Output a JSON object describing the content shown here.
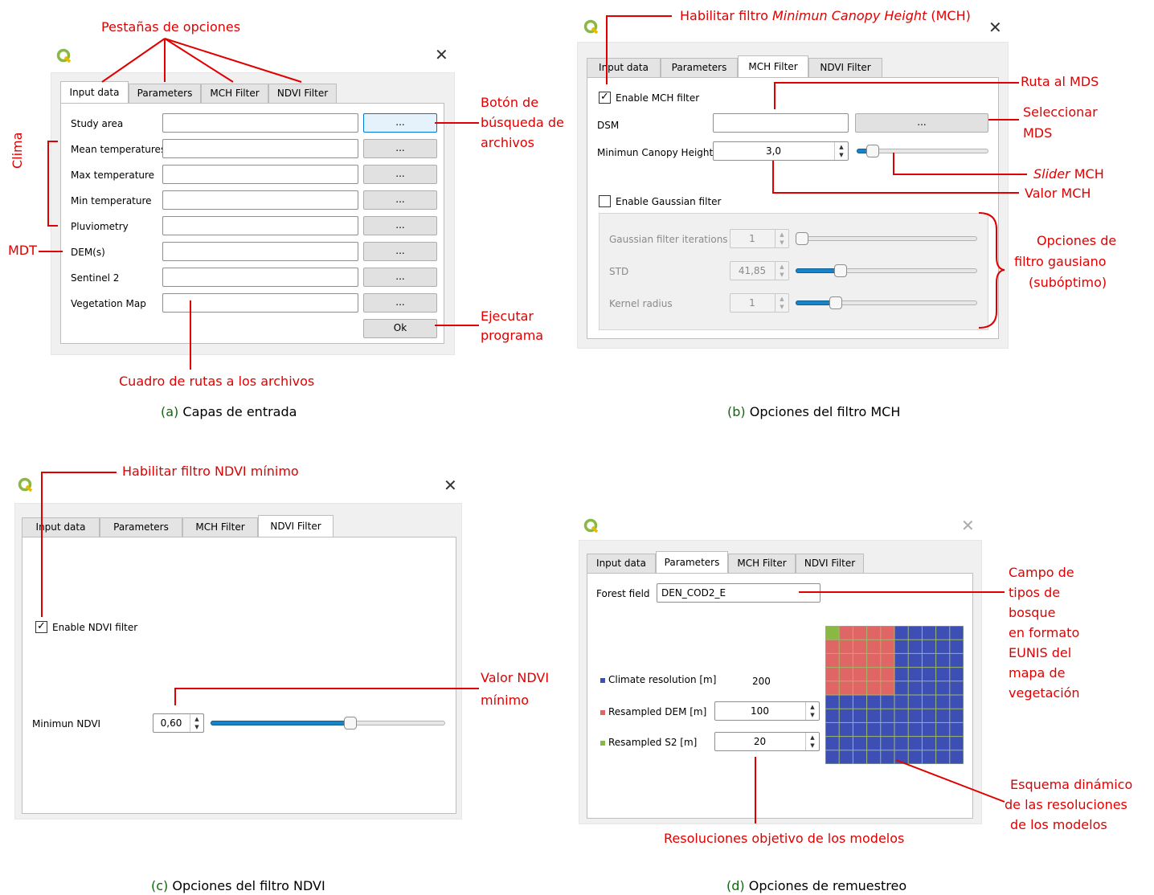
{
  "colors": {
    "annotation": "#e00000",
    "caption_label": "#116611",
    "slider_fill": "#1a82c6",
    "grid_red": "#e06666",
    "grid_blue": "#3d4fb5",
    "grid_green": "#8ab845"
  },
  "icons": {
    "logo": "qgis-logo-icon",
    "close": "close-icon",
    "combo": "spin-arrows-icon"
  },
  "panel_a": {
    "tabs": [
      "Input data",
      "Parameters",
      "MCH Filter",
      "NDVI Filter"
    ],
    "rows": [
      {
        "label": "Study area",
        "browse": "..."
      },
      {
        "label": "Mean temperatures",
        "browse": "..."
      },
      {
        "label": "Max temperature",
        "browse": "..."
      },
      {
        "label": "Min temperature",
        "browse": "..."
      },
      {
        "label": "Pluviometry",
        "browse": "..."
      },
      {
        "label": "DEM(s)",
        "browse": "..."
      },
      {
        "label": "Sentinel 2",
        "browse": "..."
      },
      {
        "label": "Vegetation Map",
        "browse": "..."
      }
    ],
    "ok": "Ok",
    "caption_letter": "(a)",
    "caption": "Capas de entrada",
    "ann_tabs": "Pestañas de opciones",
    "ann_browse": [
      "Botón de",
      "búsqueda de",
      "archivos"
    ],
    "ann_clima": "Clima",
    "ann_mdt": "MDT",
    "ann_run": [
      "Ejecutar",
      "programa"
    ],
    "ann_paths": "Cuadro de rutas a los archivos"
  },
  "panel_b": {
    "tabs": [
      "Input data",
      "Parameters",
      "MCH Filter",
      "NDVI Filter"
    ],
    "enable_mch": "Enable MCH filter",
    "dsm": "DSM",
    "browse": "...",
    "mch_label": "Minimun Canopy Height",
    "mch_value": "3,0",
    "mch_slider": 0.08,
    "enable_gauss": "Enable Gaussian filter",
    "gauss_iter_label": "Gaussian filter iterations",
    "gauss_iter_value": "1",
    "gauss_iter_slider": 0.0,
    "std_label": "STD",
    "std_value": "41,85",
    "std_slider": 0.23,
    "kernel_label": "Kernel radius",
    "kernel_value": "1",
    "kernel_slider": 0.2,
    "caption_letter": "(b)",
    "caption": "Opciones del filtro MCH",
    "ann_enable_pre": "Habilitar filtro ",
    "ann_enable_em": "Minimun Canopy Height",
    "ann_enable_post": " (MCH)",
    "ann_ruta": "Ruta al MDS",
    "ann_sel": [
      "Seleccionar",
      "MDS"
    ],
    "ann_slider_em": "Slider",
    "ann_slider_post": " MCH",
    "ann_valor": "Valor MCH",
    "ann_gauss": [
      "Opciones de",
      "filtro gausiano",
      "(subóptimo)"
    ]
  },
  "panel_c": {
    "tabs": [
      "Input data",
      "Parameters",
      "MCH Filter",
      "NDVI Filter"
    ],
    "enable_ndvi": "Enable NDVI filter",
    "min_ndvi_label": "Minimun NDVI",
    "min_ndvi_value": "0,60",
    "ndvi_slider": 0.6,
    "caption_letter": "(c)",
    "caption": "Opciones del filtro NDVI",
    "ann_enable": "Habilitar filtro NDVI mínimo",
    "ann_valor": [
      "Valor NDVI",
      "mínimo"
    ]
  },
  "panel_d": {
    "tabs": [
      "Input data",
      "Parameters",
      "MCH Filter",
      "NDVI Filter"
    ],
    "forest_label": "Forest field",
    "forest_value": "DEN_COD2_E",
    "climate_label": "Climate resolution [m]",
    "climate_value": "200",
    "dem_label": "Resampled DEM [m]",
    "dem_value": "100",
    "s2_label": "Resampled S2 [m]",
    "s2_value": "20",
    "caption_letter": "(d)",
    "caption": "Opciones de remuestreo",
    "ann_forest": [
      "Campo de",
      "tipos de",
      "bosque",
      "en formato",
      "EUNIS del",
      "mapa de",
      "vegetación"
    ],
    "ann_scheme": [
      "Esquema dinámico",
      "de las resoluciones",
      "de los modelos"
    ],
    "ann_res": "Resoluciones objetivo de los modelos"
  }
}
